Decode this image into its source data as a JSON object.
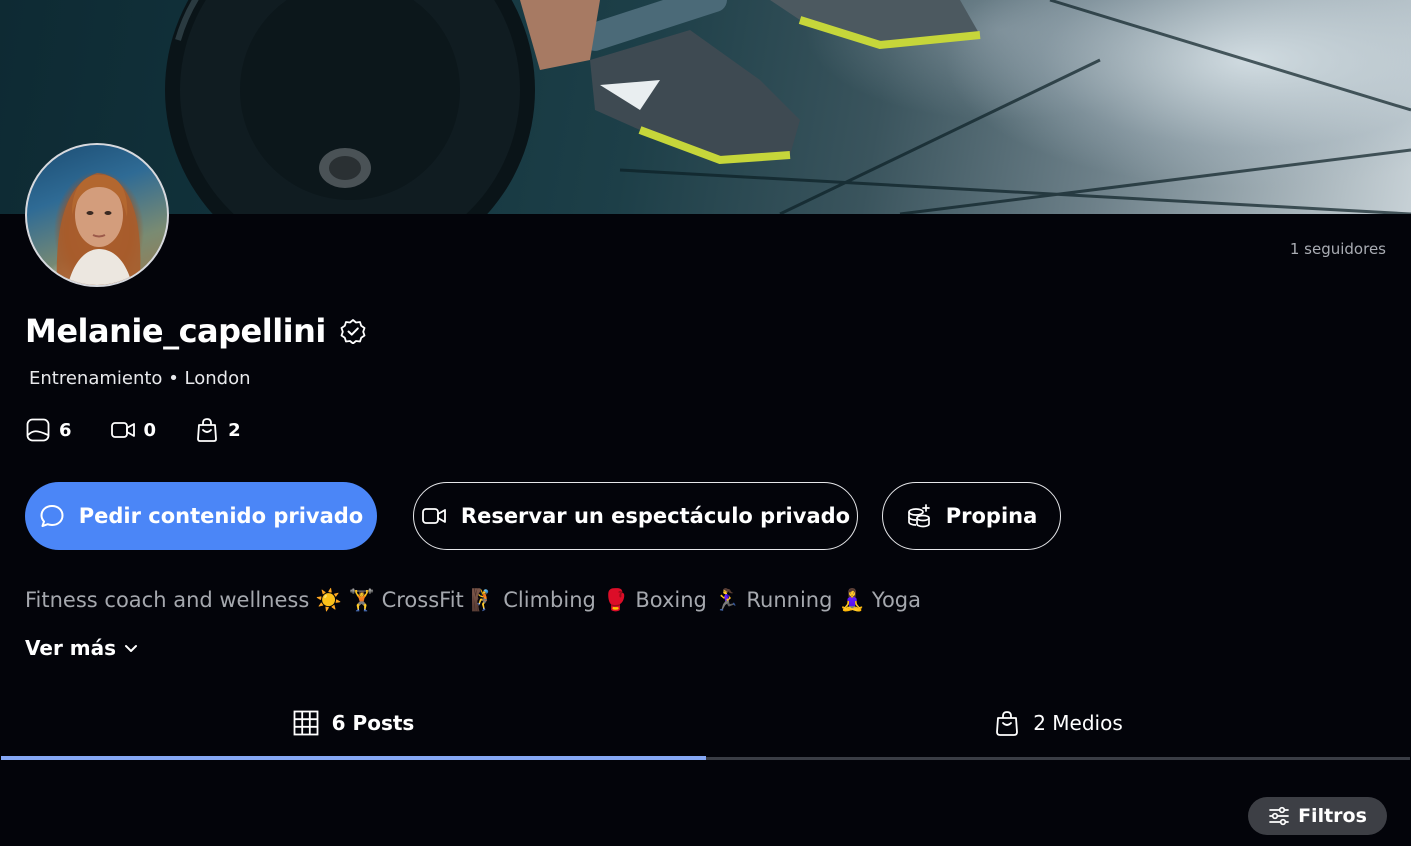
{
  "profile": {
    "followers": "1 seguidores",
    "username": "Melanie_capellini",
    "category": "Entrenamiento",
    "location": "London",
    "separator": "•"
  },
  "stats": {
    "photos": "6",
    "videos": "0",
    "products": "2"
  },
  "actions": {
    "request_content": "Pedir contenido privado",
    "book_show": "Reservar un espectáculo privado",
    "tip": "Propina"
  },
  "bio": {
    "text": "Fitness coach and wellness ☀️ 🏋 CrossFit 🧗 Climbing 🥊 Boxing 🏃‍♀️ Running 🧘‍♀️ Yoga",
    "see_more": "Ver más"
  },
  "tabs": [
    {
      "label": "6 Posts",
      "icon": "grid-icon",
      "active": true
    },
    {
      "label": "2 Medios",
      "icon": "shopping-bag-icon",
      "active": false
    }
  ],
  "filters_label": "Filtros",
  "colors": {
    "primary": "#4b86f7",
    "background": "#03040a",
    "tab_active": "#86a8f5",
    "filters_bg": "#3d3f45"
  }
}
